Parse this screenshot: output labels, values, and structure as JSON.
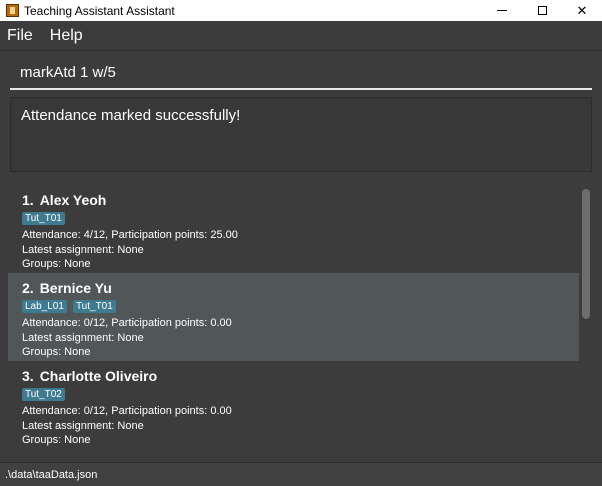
{
  "window": {
    "title": "Teaching Assistant Assistant",
    "minimize_icon": "minimize-icon",
    "maximize_icon": "maximize-icon",
    "close_icon": "close-icon",
    "close_glyph": "✕"
  },
  "menu": {
    "items": [
      {
        "label": "File"
      },
      {
        "label": "Help"
      }
    ]
  },
  "command": {
    "value": "markAtd 1 w/5"
  },
  "result": {
    "text": "Attendance marked successfully!"
  },
  "students": [
    {
      "index": "1.",
      "name": "Alex Yeoh",
      "tags": [
        "Tut_T01"
      ],
      "attendance": "Attendance: 4/12, Participation points: 25.00",
      "assignment": "Latest assignment: None",
      "groups": "Groups: None"
    },
    {
      "index": "2.",
      "name": "Bernice Yu",
      "tags": [
        "Lab_L01",
        "Tut_T01"
      ],
      "attendance": "Attendance: 0/12, Participation points: 0.00",
      "assignment": "Latest assignment: None",
      "groups": "Groups: None"
    },
    {
      "index": "3.",
      "name": "Charlotte Oliveiro",
      "tags": [
        "Tut_T02"
      ],
      "attendance": "Attendance: 0/12, Participation points: 0.00",
      "assignment": "Latest assignment: None",
      "groups": "Groups: None"
    }
  ],
  "status": {
    "path": ".\\data\\taaData.json"
  },
  "colors": {
    "background": "#3c3c3c",
    "selected_row": "#515658",
    "tag": "#3e7b91"
  }
}
